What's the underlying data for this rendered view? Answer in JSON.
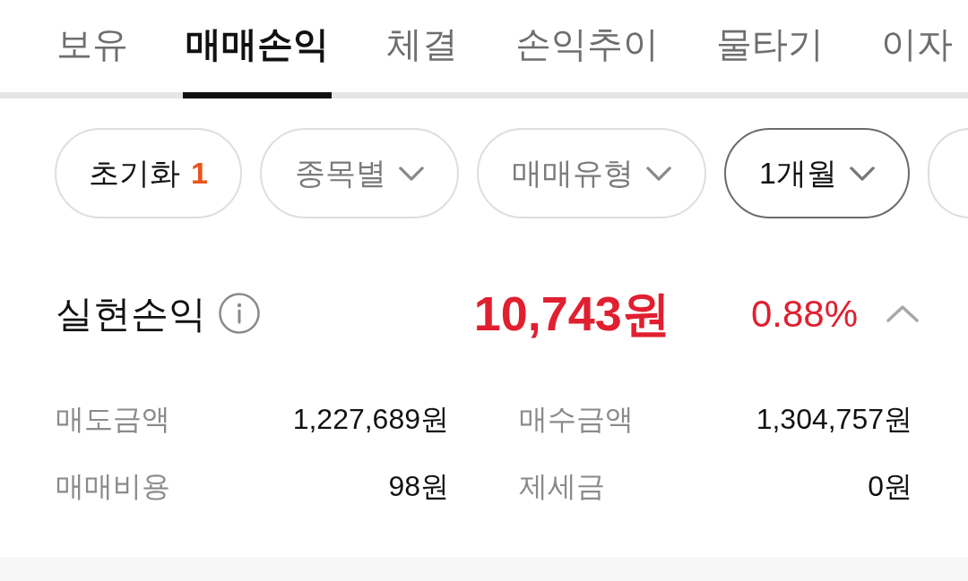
{
  "tabs": [
    {
      "label": "보유",
      "selected": false
    },
    {
      "label": "매매손익",
      "selected": true
    },
    {
      "label": "체결",
      "selected": false
    },
    {
      "label": "손익추이",
      "selected": false
    },
    {
      "label": "물타기",
      "selected": false
    },
    {
      "label": "이자",
      "selected": false
    }
  ],
  "filters": [
    {
      "kind": "reset",
      "label": "초기화",
      "count": "1",
      "selected": false
    },
    {
      "kind": "dropdown",
      "label": "종목별",
      "selected": false
    },
    {
      "kind": "dropdown",
      "label": "매매유형",
      "selected": false
    },
    {
      "kind": "dropdown",
      "label": "1개월",
      "selected": true
    }
  ],
  "summary": {
    "label": "실현손익",
    "amount": "10,743원",
    "rate": "0.88%",
    "expanded": true
  },
  "details": [
    {
      "label": "매도금액",
      "value": "1,227,689원"
    },
    {
      "label": "매수금액",
      "value": "1,304,757원"
    },
    {
      "label": "매매비용",
      "value": "98원"
    },
    {
      "label": "제세금",
      "value": "0원"
    }
  ]
}
